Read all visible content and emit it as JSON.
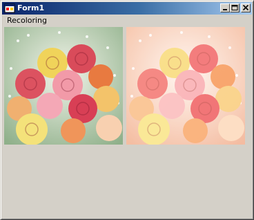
{
  "window": {
    "title": "Form1",
    "icon": "form-app-icon",
    "controls": [
      "minimize-icon",
      "maximize-icon",
      "close-icon"
    ]
  },
  "menu": {
    "items": [
      {
        "label": "Recoloring"
      }
    ]
  },
  "pictures": {
    "original": {
      "icon": "roses-bouquet-image"
    },
    "recolored": {
      "icon": "roses-bouquet-image"
    }
  },
  "colors": {
    "face": "#d4d0c8",
    "title_start": "#0a246a",
    "title_end": "#a6caf0"
  }
}
